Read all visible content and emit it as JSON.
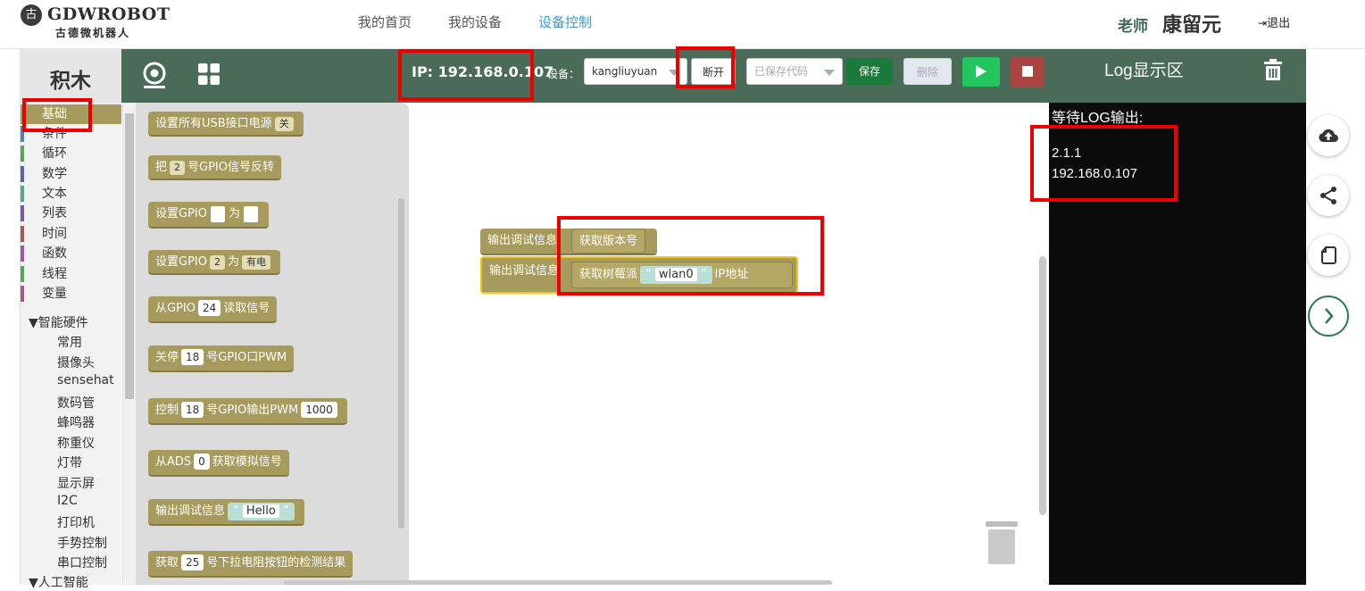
{
  "header": {
    "logo_mark": "古",
    "logo_name": "GDWROBOT",
    "logo_sub": "古德微机器人",
    "nav": [
      {
        "label": "我的首页",
        "active": false
      },
      {
        "label": "我的设备",
        "active": false
      },
      {
        "label": "设备控制",
        "active": true
      }
    ],
    "role": "老师",
    "user_name": "康留元",
    "logout_label": "退出"
  },
  "sidebar": {
    "title": "积木",
    "categories": [
      {
        "label": "基础",
        "color": "#a69a5c",
        "selected": true
      },
      {
        "label": "条件",
        "color": "#5b80a5"
      },
      {
        "label": "循环",
        "color": "#5ba55b"
      },
      {
        "label": "数学",
        "color": "#5b67a5"
      },
      {
        "label": "文本",
        "color": "#5ba58c"
      },
      {
        "label": "列表",
        "color": "#745ba5"
      },
      {
        "label": "时间",
        "color": "#a55b5b"
      },
      {
        "label": "函数",
        "color": "#995ba5"
      },
      {
        "label": "线程",
        "color": "#5ba55b"
      },
      {
        "label": "变量",
        "color": "#a55b80"
      }
    ],
    "tree_smart": "▼智能硬件",
    "smart_items": [
      "常用",
      "摄像头",
      "sensehat",
      "数码管",
      "蜂鸣器",
      "称重仪",
      "灯带",
      "显示屏",
      "I2C",
      "打印机",
      "手势控制",
      "串口控制"
    ],
    "tree_ai": "▼人工智能"
  },
  "toolbar": {
    "ip_label": "IP: 192.168.0.107",
    "device_label": "设备：",
    "device_value": "kangliuyuan",
    "disconnect_label": "断开",
    "saved_code_placeholder": "已保存代码",
    "save_label": "保存",
    "delete_label": "删除",
    "log_title": "Log显示区"
  },
  "palette": {
    "b1": {
      "text": "设置所有USB接口电源",
      "dd": "关"
    },
    "b2": {
      "pre": "把",
      "dd": "2",
      "post": "号GPIO信号反转"
    },
    "b3": {
      "pre": "设置GPIO",
      "mid": "为"
    },
    "b4": {
      "pre": "设置GPIO",
      "dd1": "2",
      "mid": "为",
      "dd2": "有电"
    },
    "b5": {
      "pre": "从GPIO",
      "val": "24",
      "post": "读取信号"
    },
    "b6": {
      "pre": "关停",
      "val": "18",
      "post": "号GPIO口PWM"
    },
    "b7": {
      "pre": "控制",
      "val": "18",
      "post": "号GPIO输出PWM",
      "val2": "1000"
    },
    "b8": {
      "pre": "从ADS",
      "val": "0",
      "post": "获取模拟信号"
    },
    "b9": {
      "pre": "输出调试信息",
      "text": "Hello"
    },
    "b10": {
      "pre": "获取",
      "val": "25",
      "post": "号下拉电阻按钮的检测结果"
    }
  },
  "workspace": {
    "w1": {
      "label": "输出调试信息",
      "inner": "获取版本号"
    },
    "w2": {
      "label": "输出调试信息",
      "inner": "获取树莓派",
      "text": "wlan0",
      "post": "IP地址"
    }
  },
  "log": {
    "waiting": "等待LOG输出:",
    "lines": [
      "2.1.1",
      "192.168.0.107"
    ]
  },
  "colors": {
    "toolbar_green": "#4a6b57",
    "block_olive": "#a69a5c",
    "save_green": "#1a7a3a",
    "run_green": "#22c55e",
    "stop_red": "#a94442",
    "annotation_red": "#e00000"
  }
}
